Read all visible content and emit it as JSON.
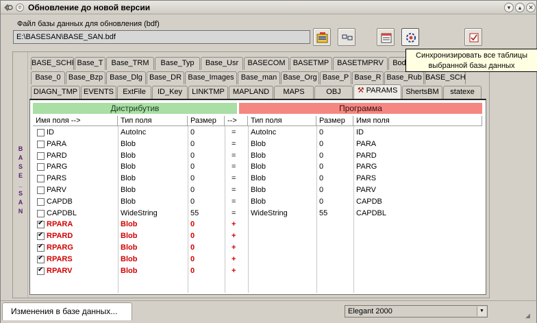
{
  "window": {
    "title": "Обновление до новой версии",
    "buttons": [
      "▾",
      "▴",
      "✕"
    ]
  },
  "file": {
    "label": "Файл базы данных для обновления (bdf)",
    "value": "E:\\BASESAN\\BASE_SAN.bdf"
  },
  "toolbar": {
    "open_icon": "open-file-icon",
    "compare_icon": "compare-icon",
    "table_icon": "table-list-icon",
    "sync_icon": "sync-gear-icon",
    "close_icon": "close-checkbox-icon"
  },
  "tooltip": {
    "line1": "Синхронизировать все таблицы",
    "line2": "выбранной базы данных"
  },
  "vertical_tab": "B\nA\nS\nE\n_\nS\nA\nN",
  "tabs": {
    "row1": [
      "BASE_SCHRR",
      "Base_T",
      "Base_TRM",
      "Base_Typ",
      "Base_Usr",
      "BASECOM",
      "BASETMP",
      "BASETMPRV",
      "Bod"
    ],
    "row2": [
      "Base_0",
      "Base_Bzp",
      "Base_Dlg",
      "Base_DR",
      "Base_Images",
      "Base_man",
      "Base_Org",
      "Base_P",
      "Base_R",
      "Base_Rub",
      "BASE_SCHR"
    ],
    "row3": [
      "DIAGN_TMP",
      "EVENTS",
      "ExtFile",
      "ID_Key",
      "LINKTMP",
      "MAPLAND",
      "MAPS",
      "OBJ",
      "PARAMS",
      "ShertsBM",
      "statexe"
    ],
    "active": "PARAMS"
  },
  "grid": {
    "left_header": "Дистрибутив",
    "right_header": "Программа",
    "columns": [
      "Имя поля -->",
      "Тип поля",
      "Размер",
      "-->",
      "Тип поля",
      "Размер",
      "Имя поля"
    ],
    "rows": [
      {
        "checked": false,
        "red": false,
        "name": "ID",
        "type": "AutoInc",
        "size": "0",
        "op": "=",
        "rtype": "AutoInc",
        "rsize": "0",
        "rname": "ID"
      },
      {
        "checked": false,
        "red": false,
        "name": "PARA",
        "type": "Blob",
        "size": "0",
        "op": "=",
        "rtype": "Blob",
        "rsize": "0",
        "rname": "PARA"
      },
      {
        "checked": false,
        "red": false,
        "name": "PARD",
        "type": "Blob",
        "size": "0",
        "op": "=",
        "rtype": "Blob",
        "rsize": "0",
        "rname": "PARD"
      },
      {
        "checked": false,
        "red": false,
        "name": "PARG",
        "type": "Blob",
        "size": "0",
        "op": "=",
        "rtype": "Blob",
        "rsize": "0",
        "rname": "PARG"
      },
      {
        "checked": false,
        "red": false,
        "name": "PARS",
        "type": "Blob",
        "size": "0",
        "op": "=",
        "rtype": "Blob",
        "rsize": "0",
        "rname": "PARS"
      },
      {
        "checked": false,
        "red": false,
        "name": "PARV",
        "type": "Blob",
        "size": "0",
        "op": "=",
        "rtype": "Blob",
        "rsize": "0",
        "rname": "PARV"
      },
      {
        "checked": false,
        "red": false,
        "name": "CAPDB",
        "type": "Blob",
        "size": "0",
        "op": "=",
        "rtype": "Blob",
        "rsize": "0",
        "rname": "CAPDB"
      },
      {
        "checked": false,
        "red": false,
        "name": "CAPDBL",
        "type": "WideString",
        "size": "55",
        "op": "=",
        "rtype": "WideString",
        "rsize": "55",
        "rname": "CAPDBL"
      },
      {
        "checked": true,
        "red": true,
        "name": "RPARA",
        "type": "Blob",
        "size": "0",
        "op": "+",
        "rtype": "",
        "rsize": "",
        "rname": ""
      },
      {
        "checked": true,
        "red": true,
        "name": "RPARD",
        "type": "Blob",
        "size": "0",
        "op": "+",
        "rtype": "",
        "rsize": "",
        "rname": ""
      },
      {
        "checked": true,
        "red": true,
        "name": "RPARG",
        "type": "Blob",
        "size": "0",
        "op": "+",
        "rtype": "",
        "rsize": "",
        "rname": ""
      },
      {
        "checked": true,
        "red": true,
        "name": "RPARS",
        "type": "Blob",
        "size": "0",
        "op": "+",
        "rtype": "",
        "rsize": "",
        "rname": ""
      },
      {
        "checked": true,
        "red": true,
        "name": "RPARV",
        "type": "Blob",
        "size": "0",
        "op": "+",
        "rtype": "",
        "rsize": "",
        "rname": ""
      }
    ]
  },
  "status": {
    "left": "Изменения в базе данных...",
    "theme": "Elegant 2000"
  },
  "colors": {
    "left_header_bg": "#a9dea5",
    "right_header_bg": "#f48782",
    "red_text": "#d00000",
    "tooltip_bg": "#ffffe1"
  }
}
